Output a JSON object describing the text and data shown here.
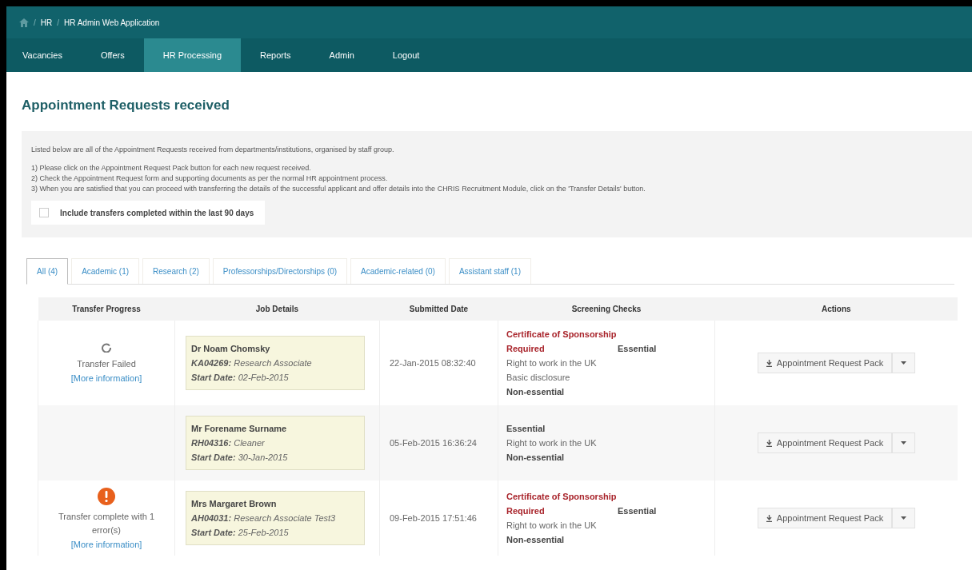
{
  "breadcrumb": [
    {
      "separator": "/",
      "label": "HR"
    },
    {
      "separator": "/",
      "label": "HR Admin Web Application"
    }
  ],
  "nav": [
    {
      "label": "Vacancies",
      "selected": false
    },
    {
      "label": "Offers",
      "selected": false
    },
    {
      "label": "HR Processing",
      "selected": true
    },
    {
      "label": "Reports",
      "selected": false
    },
    {
      "label": "Admin",
      "selected": false
    },
    {
      "label": "Logout",
      "selected": false
    }
  ],
  "title": "Appointment Requests received",
  "intro": "Listed below are all of the Appointment Requests received from departments/institutions, organised by staff group.",
  "steps": [
    "1) Please click on the Appointment Request Pack button for each new request received.",
    "2) Check the Appointment Request form and supporting documents as per the normal HR appointment process.",
    "3) When you are satisfied that you can proceed with transferring the details of the successful applicant and offer details into the CHRIS Recruitment Module, click on the 'Transfer Details' button."
  ],
  "include_transfers": {
    "label": "Include transfers completed within the last 90 days",
    "checked": false
  },
  "tabs": [
    {
      "label": "All (4)",
      "selected": true
    },
    {
      "label": "Academic (1)",
      "selected": false
    },
    {
      "label": "Research (2)",
      "selected": false
    },
    {
      "label": "Professorships/Directorships (0)",
      "selected": false
    },
    {
      "label": "Academic-related (0)",
      "selected": false
    },
    {
      "label": "Assistant staff (1)",
      "selected": false
    }
  ],
  "table": {
    "columns": [
      "Transfer Progress",
      "Job Details",
      "Submitted Date",
      "Screening Checks",
      "Actions"
    ],
    "rows": [
      {
        "progress": {
          "kind": "failed",
          "text": "Transfer Failed",
          "link": "[More information]"
        },
        "name": "Dr Noam Chomsky",
        "ref": "KA04269:",
        "job": "Research Associate",
        "start_label": "Start Date:",
        "start": "02-Feb-2015",
        "submitted": "22-Jan-2015 08:32:40",
        "checks": [
          {
            "kind": "required",
            "text": "Certificate of Sponsorship Required"
          },
          {
            "kind": "heading",
            "text": "Essential"
          },
          {
            "kind": "check",
            "text": "Right to work in the UK"
          },
          {
            "kind": "check",
            "text": "Basic disclosure"
          },
          {
            "kind": "heading",
            "text": "Non-essential"
          }
        ],
        "action": "Appointment Request Pack"
      },
      {
        "progress": {
          "kind": "none"
        },
        "name": "Mr Forename Surname",
        "ref": "RH04316:",
        "job": "Cleaner",
        "start_label": "Start Date:",
        "start": "30-Jan-2015",
        "submitted": "05-Feb-2015 16:36:24",
        "checks": [
          {
            "kind": "heading",
            "text": "Essential"
          },
          {
            "kind": "check",
            "text": "Right to work in the UK"
          },
          {
            "kind": "heading",
            "text": "Non-essential"
          }
        ],
        "action": "Appointment Request Pack"
      },
      {
        "progress": {
          "kind": "error",
          "text": "Transfer complete with 1 error(s)",
          "link": "[More information]"
        },
        "name": "Mrs Margaret Brown",
        "ref": "AH04031:",
        "job": "Research Associate Test3",
        "start_label": "Start Date:",
        "start": "25-Feb-2015",
        "submitted": "09-Feb-2015 17:51:46",
        "checks": [
          {
            "kind": "required",
            "text": "Certificate of Sponsorship Required"
          },
          {
            "kind": "heading",
            "text": "Essential"
          },
          {
            "kind": "check",
            "text": "Right to work in the UK"
          },
          {
            "kind": "heading",
            "text": "Non-essential"
          }
        ],
        "action": "Appointment Request Pack"
      }
    ]
  }
}
